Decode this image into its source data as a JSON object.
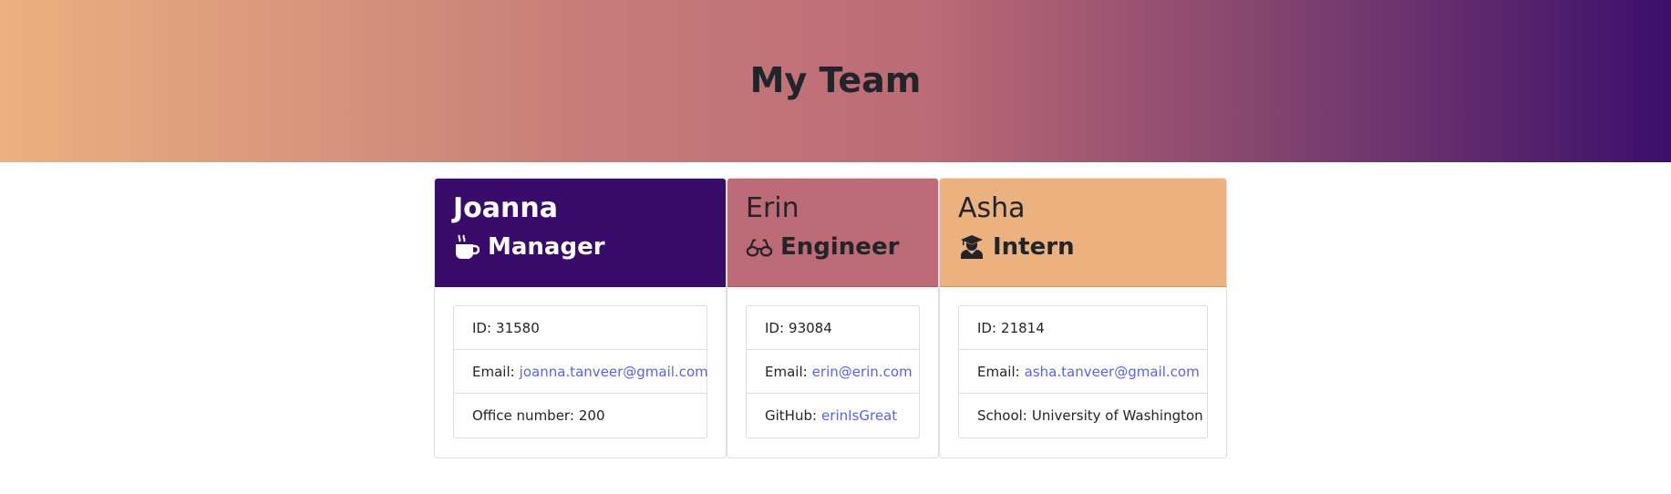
{
  "header": {
    "title": "My Team"
  },
  "team": [
    {
      "name": "Joanna",
      "role": "Manager",
      "icon": "mug-icon",
      "color": "#390c6c",
      "id_label": "ID:",
      "id": "31580",
      "email_label": "Email:",
      "email": "joanna.tanveer@gmail.com",
      "extra_label": "Office number:",
      "extra": "200"
    },
    {
      "name": "Erin",
      "role": "Engineer",
      "icon": "glasses-icon",
      "color": "#bd6b76",
      "id_label": "ID:",
      "id": "93084",
      "email_label": "Email:",
      "email": "erin@erin.com",
      "extra_label": "GitHub:",
      "extra": "erinIsGreat"
    },
    {
      "name": "Asha",
      "role": "Intern",
      "icon": "graduate-icon",
      "color": "#ebb17f",
      "id_label": "ID:",
      "id": "21814",
      "email_label": "Email:",
      "email": "asha.tanveer@gmail.com",
      "extra_label": "School:",
      "extra": "University of Washington"
    }
  ],
  "colors": {
    "gradient_start": "#ebb17f",
    "gradient_end": "#3b0f6c",
    "link": "#5a63e0"
  }
}
